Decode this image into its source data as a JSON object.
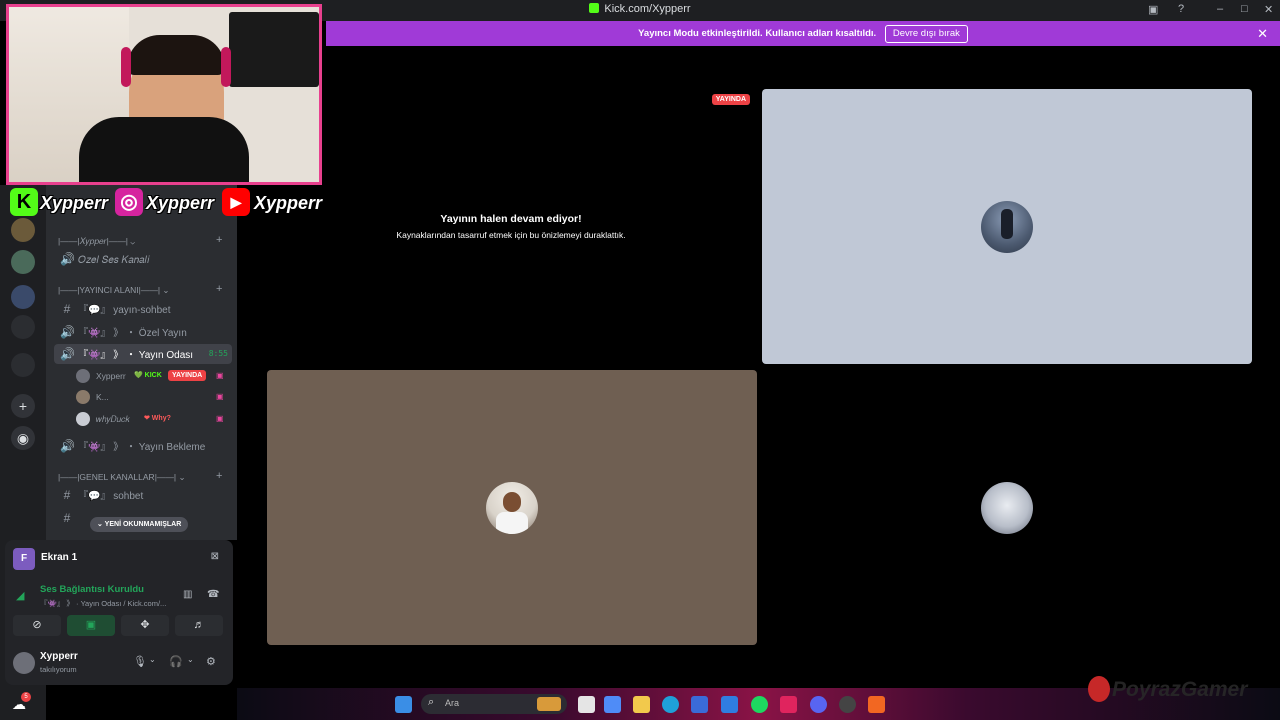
{
  "window": {
    "title": "Kick.com/Xypperr",
    "controls": [
      "–",
      "□",
      "✕"
    ]
  },
  "notice": {
    "text": "Yayıncı Modu etkinleştirildi. Kullanıcı adları kısaltıldı.",
    "button": "Devre dışı bırak",
    "close": "✕"
  },
  "stage": {
    "live_badge": "YAYINDA",
    "paused_title": "Yayının halen devam ediyor!",
    "paused_subtitle": "Kaynaklarından tasarruf etmek için bu önizlemeyi duraklattık."
  },
  "overlay": {
    "socials": [
      {
        "platform": "kick",
        "symbol": "K",
        "color": "#53fc18",
        "name": "Xypperr"
      },
      {
        "platform": "instagram",
        "symbol": "◎",
        "color": "#d6249f",
        "name": "Xypperr"
      },
      {
        "platform": "youtube",
        "symbol": "▶",
        "color": "#ff0000",
        "name": "Xypperr"
      }
    ]
  },
  "sidebar": {
    "categories": [
      {
        "label": "|——|𝑋𝑦𝑝𝑝𝑒𝑟|——|",
        "chevron": "⌄",
        "plus": "+"
      },
      {
        "label": "|——|YAYINCI ALANI|——|",
        "chevron": "⌄",
        "plus": "+"
      },
      {
        "label": "|——|GENEL KANALLAR|——|",
        "chevron": "⌄",
        "plus": "+"
      }
    ],
    "channels": {
      "ozel_ses": "𝑂𝑧𝑒𝑙 𝑆𝑒𝑠 𝐾𝑎𝑛𝑎𝑙𝑖",
      "yayin_sohbet": "『💬』 yayın-sohbet",
      "ozel_yayin": "『👾』 》 ・ Özel Yayın",
      "yayin_odasi": "『👾』 》 ・ Yayın Odası",
      "yayin_odasi_timer": "8:55",
      "yayin_bekleme": "『👾』 》 ・ Yayın Bekleme",
      "sohbet": "『💬』 sohbet"
    },
    "voice_users": [
      {
        "name": "Xypperr",
        "tag": "💚 KICK",
        "tag_color": "#53fc18",
        "live": "YAYINDA"
      },
      {
        "name": "K...",
        "tag": "",
        "tag_color": "#ffffff",
        "live": ""
      },
      {
        "name": "𝑤ℎ𝑦𝐷𝑢𝑐𝑘",
        "tag": "❤ Why?",
        "tag_color": "#ff5a5a",
        "live": ""
      }
    ],
    "unread_pill": "⌄ YENİ OKUNMAMIŞLAR",
    "rail": {
      "add": "+",
      "discover": "◉"
    }
  },
  "panel": {
    "screen_initial": "F",
    "screen_name": "Ekran 1",
    "voice_status": "Ses Bağlantısı Kuruldu",
    "voice_detail": "『👾』 》 · Yayın Odası / Kick.com/...",
    "user_name": "Xypperr",
    "user_status": "takılıyorum"
  },
  "taskbar": {
    "search_placeholder": "Ara",
    "tray_badge": "5",
    "watermark": "PoyrazGamer"
  },
  "colors": {
    "accent_purple": "#a03ad7",
    "live_red": "#ed4245",
    "connected_green": "#23a55a",
    "webcam_border": "#e8408e",
    "kick_green": "#53fc18"
  }
}
